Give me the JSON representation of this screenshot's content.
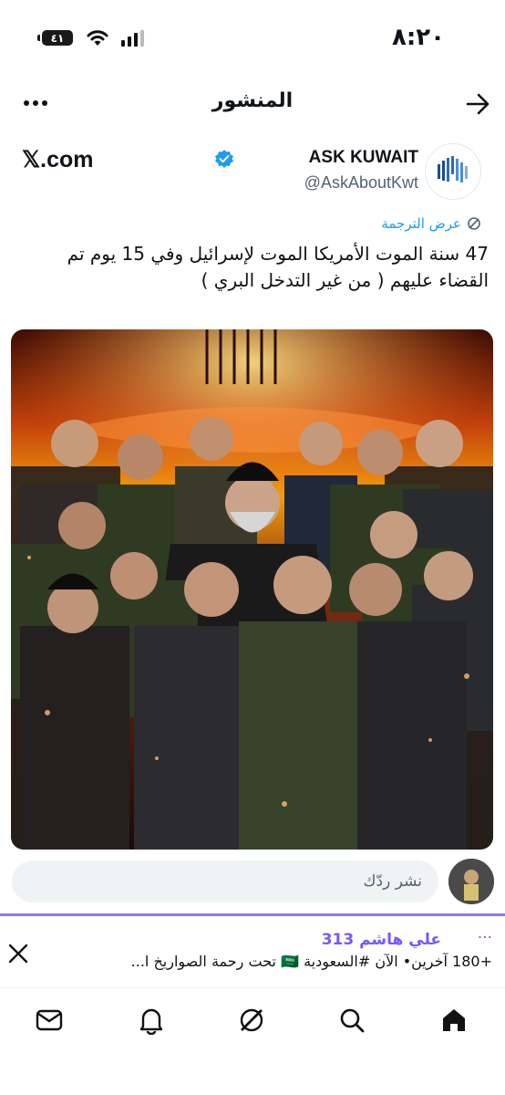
{
  "status_bar": {
    "time": "٨:٢٠",
    "battery": "٤١"
  },
  "header": {
    "title": "المنشور"
  },
  "author": {
    "name": "ASK KUWAIT",
    "handle": "@AskAboutKwt",
    "source": "𝕏.com"
  },
  "translate": {
    "label": "عرض الترجمة"
  },
  "post": {
    "text": "47 سنة الموت الأمريكا الموت لإسرائيل وفي 15 يوم تم القضاء عليهم ( من غير التدخل البري )"
  },
  "reply": {
    "placeholder": "نشر ردّك"
  },
  "notification": {
    "name": "علي هاشم 313",
    "dots": "···",
    "text": "+180 آخرين•  الآن #السعودية 🇸🇦 تحت رحمة الصواريخ ا..."
  },
  "nav": {
    "icons": [
      "home-icon",
      "search-icon",
      "grok-icon",
      "notifications-icon",
      "messages-icon"
    ]
  },
  "colors": {
    "accent": "#1d9bf0",
    "purple": "#7856ff",
    "text": "#0f1419",
    "muted": "#536471"
  }
}
